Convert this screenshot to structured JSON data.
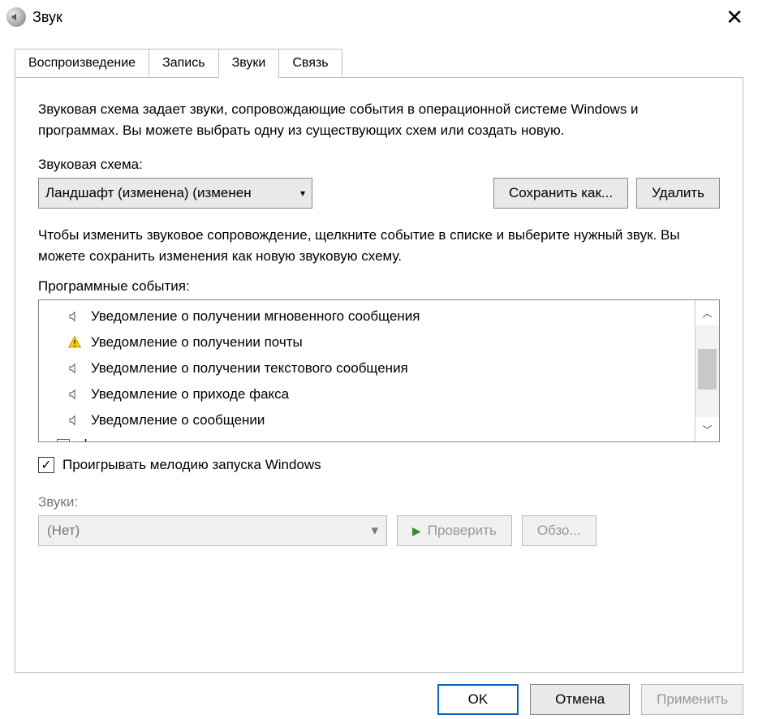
{
  "window": {
    "title": "Звук",
    "close": "✕"
  },
  "tabs": {
    "playback": "Воспроизведение",
    "recording": "Запись",
    "sounds": "Звуки",
    "communications": "Связь"
  },
  "panel": {
    "description": "Звуковая схема задает звуки, сопровождающие события в операционной системе Windows и программах. Вы можете выбрать одну из существующих схем или создать новую.",
    "scheme_label": "Звуковая схема:",
    "scheme_value": "Ландшафт (изменена) (изменен",
    "save_as": "Сохранить как...",
    "delete": "Удалить",
    "events_description": "Чтобы изменить звуковое сопровождение, щелкните событие в списке и выберите нужный звук. Вы можете сохранить изменения как новую звуковую схему.",
    "events_label": "Программные события:",
    "events": [
      {
        "label": "Уведомление о получении мгновенного сообщения",
        "icon": "speaker"
      },
      {
        "label": "Уведомление о получении почты",
        "icon": "warning"
      },
      {
        "label": "Уведомление о получении текстового сообщения",
        "icon": "speaker"
      },
      {
        "label": "Уведомление о приходе факса",
        "icon": "speaker"
      },
      {
        "label": "Уведомление о сообщении",
        "icon": "speaker"
      }
    ],
    "devenv": "devenv",
    "startup_checkbox": "Проигрывать мелодию запуска Windows",
    "startup_checked": true,
    "sounds_label": "Звуки:",
    "sounds_value": "(Нет)",
    "test_button": "Проверить",
    "browse_button": "Обзо..."
  },
  "footer": {
    "ok": "OK",
    "cancel": "Отмена",
    "apply": "Применить"
  }
}
